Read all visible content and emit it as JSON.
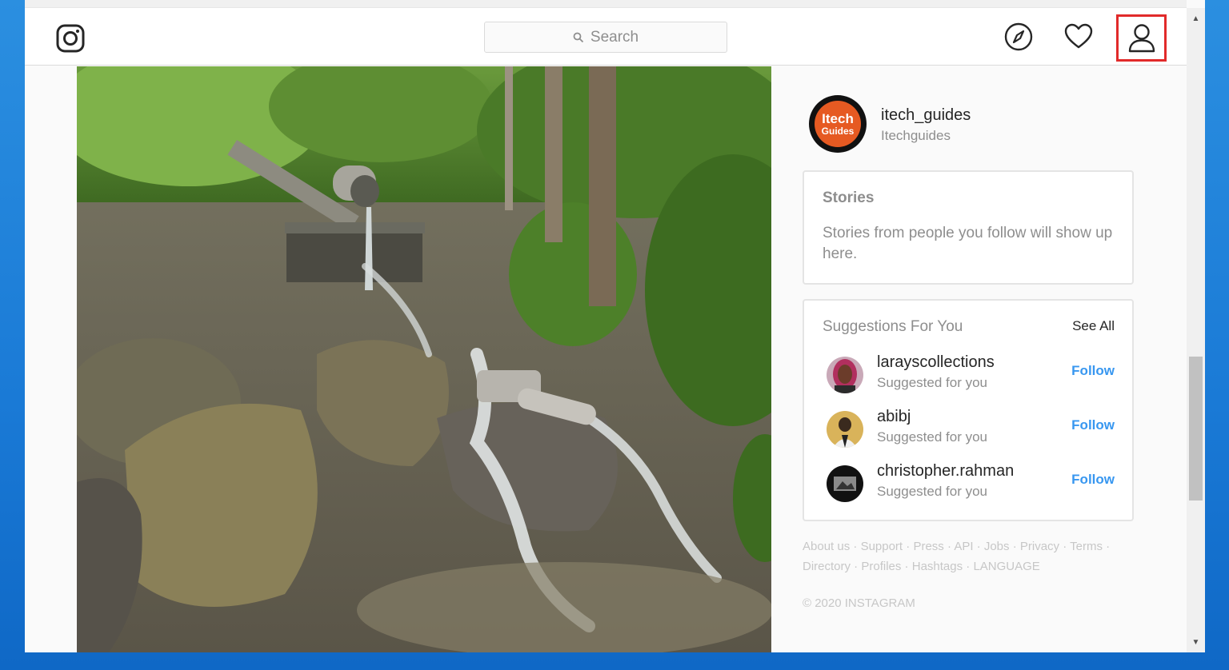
{
  "colors": {
    "accent": "#3897f0",
    "highlight_box": "#e12a2a",
    "avatar_brand": "#e65a22"
  },
  "navbar": {
    "logo_icon": "instagram-icon",
    "search": {
      "placeholder": "Search",
      "icon": "search-icon"
    },
    "icons": [
      "compass-icon",
      "heart-icon",
      "user-icon"
    ]
  },
  "profile": {
    "username": "itech_guides",
    "full_name": "Itechguides",
    "avatar_text_line1": "Itech",
    "avatar_text_line2": "Guides"
  },
  "stories": {
    "title": "Stories",
    "empty_text": "Stories from people you follow will show up here."
  },
  "suggestions": {
    "title": "Suggestions For You",
    "see_all": "See All",
    "items": [
      {
        "username": "larayscollections",
        "subtitle": "Suggested for you",
        "action": "Follow"
      },
      {
        "username": "abibj",
        "subtitle": "Suggested for you",
        "action": "Follow"
      },
      {
        "username": "christopher.rahman",
        "subtitle": "Suggested for you",
        "action": "Follow"
      }
    ]
  },
  "footer": {
    "links": [
      "About us",
      "Support",
      "Press",
      "API",
      "Jobs",
      "Privacy",
      "Terms",
      "Directory",
      "Profiles",
      "Hashtags",
      "LANGUAGE"
    ],
    "copyright": "© 2020 INSTAGRAM"
  }
}
